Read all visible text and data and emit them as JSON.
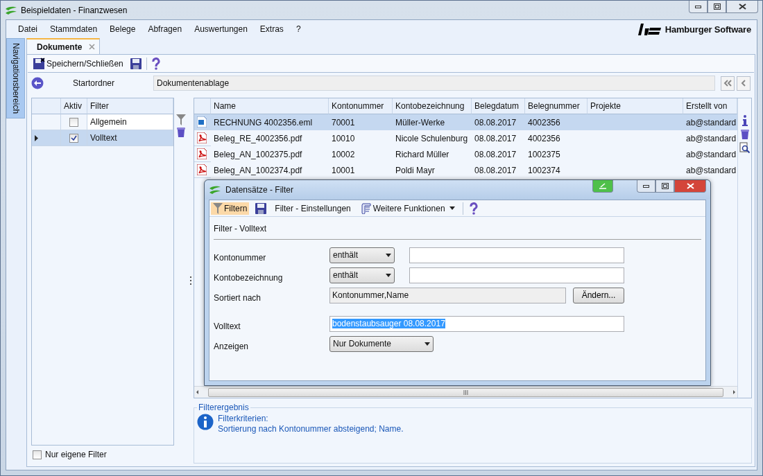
{
  "window": {
    "title": "Beispieldaten - Finanzwesen"
  },
  "menu": [
    "Datei",
    "Stammdaten",
    "Belege",
    "Abfragen",
    "Auswertungen",
    "Extras",
    "?"
  ],
  "logo": {
    "text": "Hamburger Software"
  },
  "nav_panel": {
    "label": "Navigationsbereich"
  },
  "tabs": [
    {
      "label": "Dokumente",
      "selected": true
    }
  ],
  "toolbar": [
    {
      "kind": "saveclose",
      "label": "Speichern/Schließen"
    },
    {
      "kind": "save"
    },
    {
      "kind": "help"
    }
  ],
  "start_folder": {
    "label": "Startordner",
    "value": "Dokumentenablage"
  },
  "filters": {
    "columns": [
      "Aktiv",
      "Filter"
    ],
    "rows": [
      {
        "name": "Allgemein",
        "active": false,
        "selected": false
      },
      {
        "name": "Volltext",
        "active": true,
        "selected": true
      }
    ],
    "own_only": {
      "label": "Nur eigene Filter",
      "checked": false
    }
  },
  "documents": {
    "columns": [
      "Name",
      "Kontonummer",
      "Kontobezeichnung",
      "Belegdatum",
      "Belegnummer",
      "Projekte",
      "Erstellt von"
    ],
    "rows": [
      {
        "kind": "email",
        "selected": true,
        "cells": [
          "RECHNUNG 4002356.eml",
          "70001",
          "Müller-Werke",
          "08.08.2017",
          "4002356",
          "",
          "ab@standard"
        ]
      },
      {
        "kind": "pdf",
        "selected": false,
        "cells": [
          "Beleg_RE_4002356.pdf",
          "10010",
          "Nicole Schulenburg",
          "08.08.2017",
          "4002356",
          "",
          "ab@standard"
        ]
      },
      {
        "kind": "pdf",
        "selected": false,
        "cells": [
          "Beleg_AN_1002375.pdf",
          "10002",
          "Richard Müller",
          "08.08.2017",
          "1002375",
          "",
          "ab@standard"
        ]
      },
      {
        "kind": "pdf",
        "selected": false,
        "cells": [
          "Beleg_AN_1002374.pdf",
          "10001",
          "Poldi Mayr",
          "08.08.2017",
          "1002374",
          "",
          "ab@standard"
        ]
      }
    ]
  },
  "filter_dialog": {
    "title": "Datensätze - Filter",
    "toolbar": [
      {
        "kind": "filter",
        "label": "Filtern",
        "selected": true
      },
      {
        "kind": "save"
      },
      {
        "kind": "text",
        "label": "Filter - Einstellungen"
      },
      {
        "kind": "menu",
        "label": "Weitere Funktionen"
      },
      {
        "kind": "help"
      }
    ],
    "section": "Filter - Volltext",
    "fields": [
      {
        "kind": "condition",
        "label": "Kontonummer",
        "operator": "enthält"
      },
      {
        "kind": "condition",
        "label": "Kontobezeichnung",
        "operator": "enthält"
      },
      {
        "kind": "readonly",
        "label": "Sortiert nach",
        "value": "Kontonummer,Name",
        "button": "Ändern..."
      },
      {
        "kind": "text",
        "label": "Volltext",
        "value": "bodenstaubsauger 08.08.2017",
        "highlighted": true
      },
      {
        "kind": "select",
        "label": "Anzeigen",
        "value": "Nur Dokumente"
      }
    ]
  },
  "result": {
    "legend": "Filterergebnis",
    "heading": "Filterkriterien:",
    "text": "Sortierung nach Kontonummer absteigend; Name."
  }
}
